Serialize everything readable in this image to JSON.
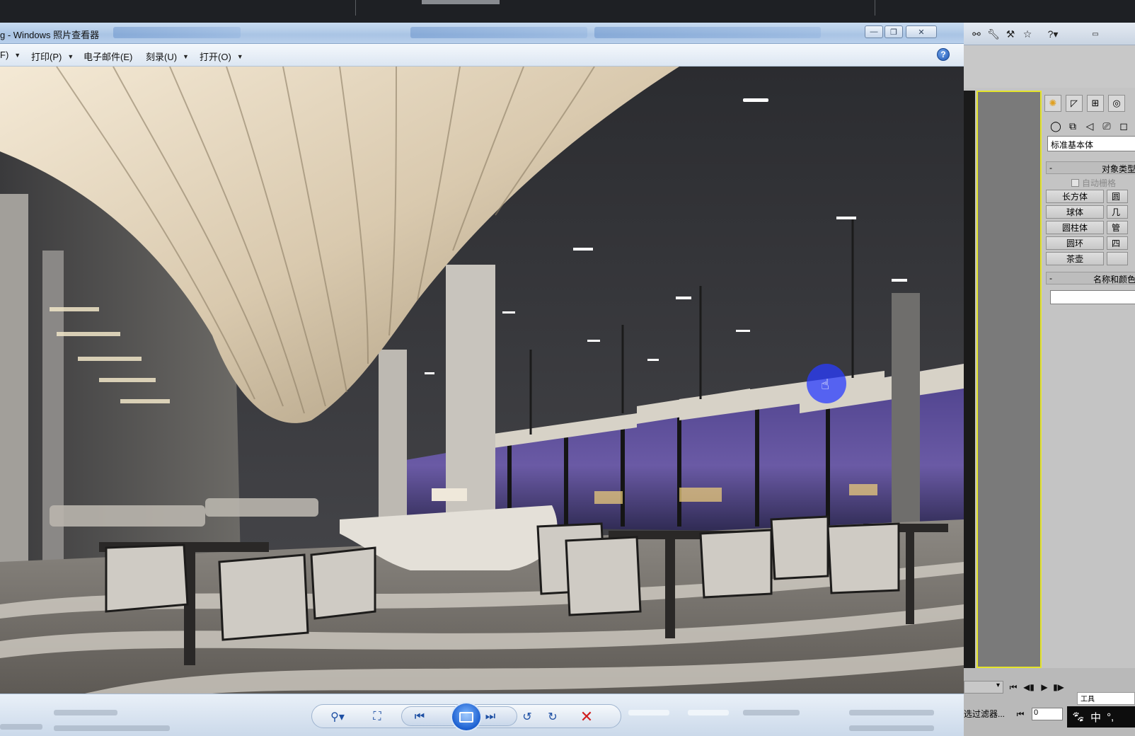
{
  "viewer": {
    "title": "g - Windows 照片查看器",
    "menu": [
      {
        "label": "F)"
      },
      {
        "label": "打印(P)"
      },
      {
        "label": "电子邮件(E)"
      },
      {
        "label": "刻录(U)"
      },
      {
        "label": "打开(O)"
      }
    ],
    "help_icon": "?",
    "caption_buttons": {
      "minimize": "—",
      "restore": "❐",
      "close": "✕"
    }
  },
  "controls": {
    "zoom_icon": "zoom-icon",
    "fit_icon": "fit-to-window-icon",
    "prev_icon": "previous-icon",
    "slideshow_icon": "slideshow-icon",
    "next_icon": "next-icon",
    "rotate_ccw_icon": "rotate-counterclockwise-icon",
    "rotate_cw_icon": "rotate-clockwise-icon",
    "delete_icon": "delete-icon"
  },
  "max_panel": {
    "category": "标准基本体",
    "object_type_header": "对象类型",
    "object_type_toggle": "-",
    "autogrid": "自动栅格",
    "buttons": [
      "长方体",
      "球体",
      "圆柱体",
      "圆环",
      "茶壶"
    ],
    "buttons_right": [
      "圆",
      "几",
      "管",
      "四",
      ""
    ],
    "name_color_header": "名称和颜色",
    "name_color_toggle": "-",
    "filter_label": "选过滤器...",
    "frame_value": "0",
    "tray_ime": "中",
    "tray_tool": "工具"
  },
  "colors": {
    "viewport_border": "#e5e52a",
    "viewer_titlebar": "#a9c4e4",
    "delete_red": "#d01d1d"
  }
}
